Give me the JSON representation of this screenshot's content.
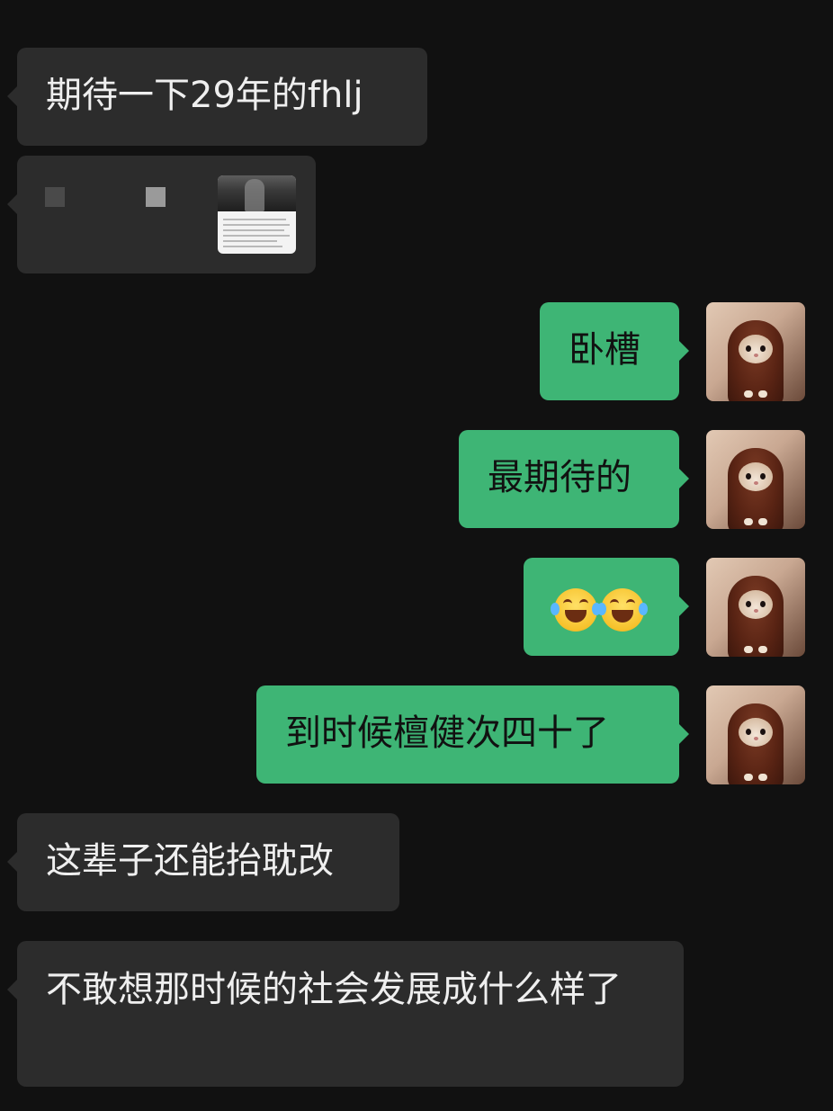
{
  "messages": [
    {
      "id": "m1",
      "side": "in",
      "text": "期待一下29年的fhlj"
    },
    {
      "id": "m2",
      "side": "in",
      "type": "shared-post"
    },
    {
      "id": "m3",
      "side": "out",
      "text": "卧槽"
    },
    {
      "id": "m4",
      "side": "out",
      "text": "最期待的"
    },
    {
      "id": "m5",
      "side": "out",
      "text": "😂😂",
      "emoji": [
        "tears-of-joy-icon",
        "tears-of-joy-icon"
      ]
    },
    {
      "id": "m6",
      "side": "out",
      "text": "到时候檀健次四十了"
    },
    {
      "id": "m7",
      "side": "in",
      "text": "这辈子还能抬耽改"
    },
    {
      "id": "m8",
      "side": "in",
      "text": "不敢想那时候的社会发展成什么样了"
    }
  ],
  "colors": {
    "background": "#111111",
    "incoming_bubble": "#2c2c2c",
    "outgoing_bubble": "#3eb575",
    "incoming_text": "#efefef",
    "outgoing_text": "#111111"
  }
}
